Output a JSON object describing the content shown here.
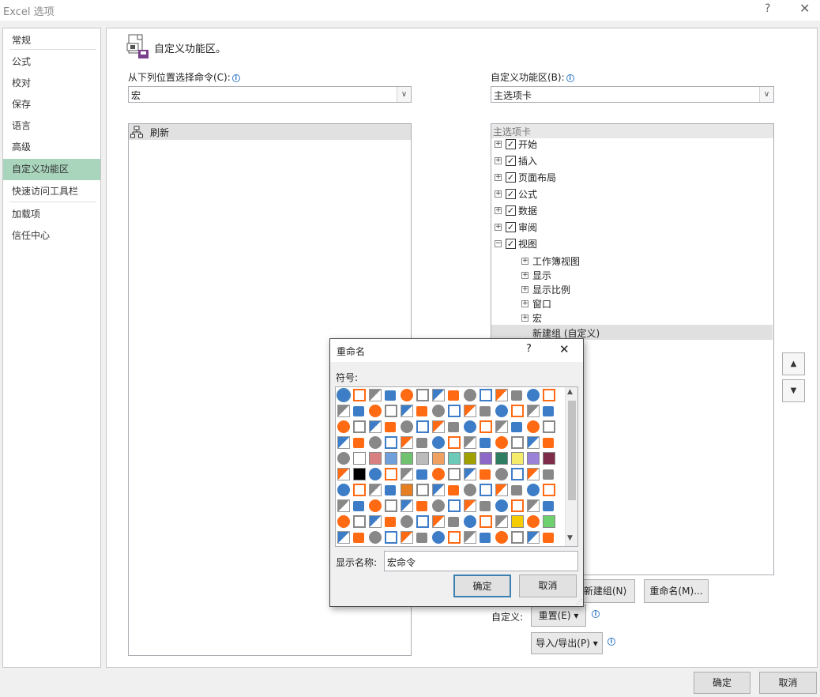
{
  "window": {
    "title": "Excel 选项",
    "help": "?",
    "close": "✕"
  },
  "sidebar": {
    "items": [
      {
        "label": "常规"
      },
      {
        "label": "公式"
      },
      {
        "label": "校对"
      },
      {
        "label": "保存"
      },
      {
        "label": "语言"
      },
      {
        "label": "高级"
      },
      {
        "label": "自定义功能区",
        "selected": true
      },
      {
        "label": "快速访问工具栏"
      },
      {
        "label": "加载项"
      },
      {
        "label": "信任中心"
      }
    ]
  },
  "main": {
    "header_title": "自定义功能区。",
    "choose_label": "从下列位置选择命令(C):",
    "choose_value": "宏",
    "commands": [
      "刷新"
    ],
    "customize_label": "自定义功能区(B):",
    "customize_value": "主选项卡",
    "tree_header": "主选项卡",
    "tree": [
      {
        "label": "开始",
        "expander": "+",
        "checked": true
      },
      {
        "label": "插入",
        "expander": "+",
        "checked": true
      },
      {
        "label": "页面布局",
        "expander": "+",
        "checked": true
      },
      {
        "label": "公式",
        "expander": "+",
        "checked": true
      },
      {
        "label": "数据",
        "expander": "+",
        "checked": true
      },
      {
        "label": "审阅",
        "expander": "+",
        "checked": true
      },
      {
        "label": "视图",
        "expander": "−",
        "checked": true
      }
    ],
    "subtree": [
      {
        "label": "工作簿视图"
      },
      {
        "label": "显示"
      },
      {
        "label": "显示比例"
      },
      {
        "label": "窗口"
      },
      {
        "label": "宏"
      }
    ],
    "new_group": "新建组 (自定义)",
    "new_group_btn": "新建组(N)",
    "rename_btn": "重命名(M)...",
    "customizations_label": "自定义:",
    "reset_btn": "重置(E) ▾",
    "import_export_btn": "导入/导出(P) ▾"
  },
  "footer": {
    "ok": "确定",
    "cancel": "取消"
  },
  "rename_dialog": {
    "title": "重命名",
    "help": "?",
    "close": "✕",
    "symbol_label": "符号:",
    "display_name_label": "显示名称:",
    "display_name_value": "宏命令",
    "ok": "确定",
    "cancel": "取消",
    "icons": [
      "hierarchy-icon",
      "error-icon",
      "info-icon",
      "target-icon",
      "warning-icon",
      "exclamation-icon",
      "alert-icon",
      "shield-icon",
      "save-icon",
      "save-as-icon",
      "print-save-icon",
      "folder-icon",
      "document-icon",
      "open-folder-icon",
      "folders-icon",
      "folder-doc-icon",
      "printer-icon",
      "picture-icon",
      "clipboard-icon",
      "home-icon",
      "pie-icon",
      "back-icon",
      "forward-icon",
      "left-arrow-icon",
      "up-triangle-icon",
      "down-triangle-icon",
      "right-arrow-icon",
      "circle-back-icon",
      "pin-icon",
      "lock-icon",
      "key-icon",
      "stamp-icon",
      "flag-icon",
      "table-icon",
      "search-icon",
      "filter-icon",
      "funnel-icon",
      "book-icon",
      "scale-icon",
      "glasses-icon",
      "microphone-icon",
      "mute-icon",
      "user-icon",
      "person-icon",
      "clock-icon",
      "snowflake-icon",
      "hand-icon",
      "smile-icon",
      "sad-icon",
      "calculator-icon",
      "phone-icon",
      "piggy-icon",
      "ball-icon",
      "dollar-icon",
      "eye-icon",
      "dash-icon",
      "grid-color-icon",
      "blank-swatch-icon",
      "red-swatch-icon",
      "blue-swatch-icon",
      "green-swatch-icon",
      "gray-swatch-icon",
      "orange-swatch-icon",
      "teal-swatch-icon",
      "olive-swatch-icon",
      "purple-swatch-icon",
      "darkgreen-swatch-icon",
      "yellow-swatch-icon",
      "lavender-swatch-icon",
      "maroon-swatch-icon",
      "contrast-icon",
      "black-square-icon",
      "frame-icon",
      "box-icon",
      "dotted-box-icon",
      "panel-icon",
      "square-icon",
      "window-icon",
      "checker-icon",
      "circle-arrow-icon",
      "circle-icon",
      "cone-icon",
      "mountain-icon",
      "chart-bar-icon",
      "pie-chart-icon",
      "star-icon",
      "cylinder-icon",
      "book-purple-icon",
      "orange-block-icon",
      "report-icon",
      "chart-line-icon",
      "doc-blank-icon",
      "badge-icon",
      "layout-icon",
      "triangle-icon",
      "flag-arrow-icon",
      "letter-a-icon",
      "letter-a-gray-icon",
      "cross-icon",
      "check-icon",
      "ruler-icon",
      "refresh-icon",
      "bracket-icon",
      "pi-icon",
      "binoculars-icon",
      "brush-icon",
      "list-icon",
      "play-icon",
      "anchor-icon",
      "bag-icon",
      "zoom-icon",
      "blank-icon",
      "copy-icon",
      "doc-lines-icon",
      "doc-fold-icon",
      "eraser-icon",
      "compass-icon",
      "leaf-icon",
      "bell-icon",
      "envelope-icon",
      "card-icon",
      "mail-icon",
      "form-icon",
      "yellow-box-icon",
      "red-stripe-icon",
      "green-box-icon",
      "browser-icon",
      "house-color-icon",
      "scissors-icon",
      "line-icon",
      "note-icon",
      "doc-globe-icon",
      "paste-icon",
      "cube-icon",
      "handshake-icon",
      "video-icon",
      "grid-icon",
      "window-frame-icon",
      "stack-icon",
      "certificate-icon"
    ]
  }
}
